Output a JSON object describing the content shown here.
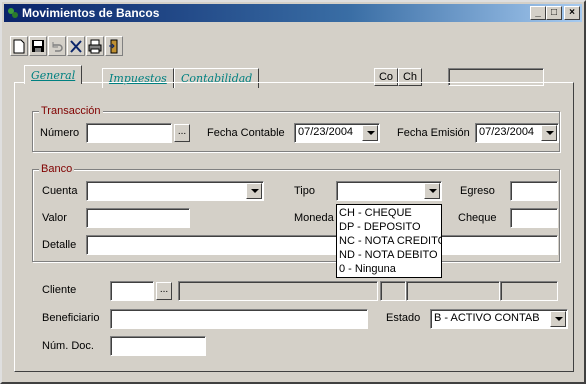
{
  "window": {
    "title": "Movimientos de Bancos",
    "min": "_",
    "max": "□",
    "close": "×"
  },
  "toolbar": {
    "buttons": [
      "new-file-icon",
      "save-disk-icon",
      "undo-icon",
      "delete-x-icon",
      "print-icon",
      "exit-door-icon"
    ]
  },
  "tabs": [
    {
      "label": "General"
    },
    {
      "label": "Impuestos"
    },
    {
      "label": "Contabilidad"
    }
  ],
  "top_buttons": {
    "co": "Co",
    "ch": "Ch"
  },
  "transaccion": {
    "legend": "Transacción",
    "numero_label": "Número",
    "numero_value": "",
    "ellipsis": "...",
    "fecha_contable_label": "Fecha Contable",
    "fecha_contable_value": "07/23/2004",
    "fecha_emision_label": "Fecha Emisión",
    "fecha_emision_value": "07/23/2004"
  },
  "banco": {
    "legend": "Banco",
    "cuenta_label": "Cuenta",
    "cuenta_value": "",
    "tipo_label": "Tipo",
    "tipo_value": "",
    "egreso_label": "Egreso",
    "valor_label": "Valor",
    "moneda_label": "Moneda",
    "cheque_label": "Cheque",
    "detalle_label": "Detalle",
    "tipo_options": [
      "CH - CHEQUE",
      "DP - DEPOSITO",
      "NC - NOTA CREDITO",
      "ND - NOTA DEBITO",
      "0 - Ninguna"
    ]
  },
  "bottom": {
    "cliente_label": "Cliente",
    "ellipsis": "...",
    "beneficiario_label": "Beneficiario",
    "estado_label": "Estado",
    "estado_value": "B - ACTIVO CONTAB",
    "num_doc_label": "Núm. Doc."
  },
  "colors": {
    "titlebar_start": "#0a246a",
    "titlebar_end": "#a6caf0",
    "face": "#d4d0c8",
    "tab_text": "#008080",
    "legend_text": "#800000"
  }
}
